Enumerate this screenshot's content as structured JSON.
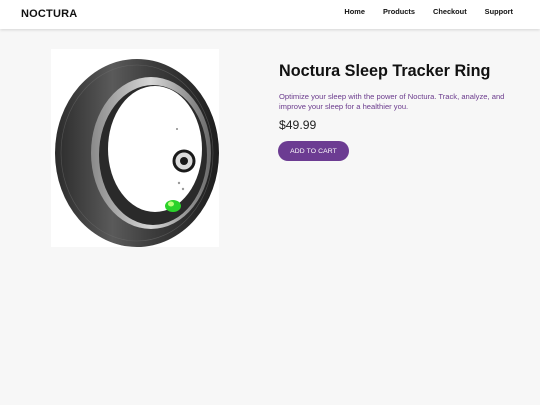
{
  "header": {
    "brand": "NOCTURA",
    "nav": [
      "Home",
      "Products",
      "Checkout",
      "Support"
    ]
  },
  "product": {
    "image_icon": "ring-product-photo",
    "title": "Noctura Sleep Tracker Ring",
    "description": "Optimize your sleep with the power of Noctura. Track, analyze, and improve your sleep for a healthier you.",
    "price": "$49.99",
    "cta_label": "ADD TO CART"
  },
  "colors": {
    "accent": "#6c3c92",
    "description_text": "#6b3b8d",
    "page_background": "#f7f7f7",
    "header_background": "#ffffff"
  }
}
